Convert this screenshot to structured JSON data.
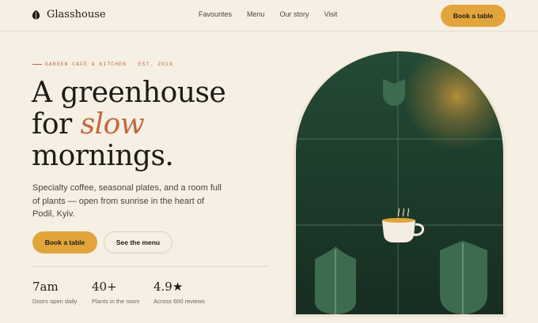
{
  "nav": {
    "brand": "Glasshouse",
    "links": [
      "Favourites",
      "Menu",
      "Our story",
      "Visit"
    ],
    "cta": "Book a table"
  },
  "hero": {
    "eyebrow": "GARDEN CAFÉ & KITCHEN · EST. 2019",
    "headline": {
      "line1": "A greenhouse",
      "line2_pre": "for ",
      "line2_accent": "slow",
      "line3": "mornings."
    },
    "lede": "Specialty coffee, seasonal plates, and a room full of plants — open from sunrise in the heart of Podil, Kyiv.",
    "primary_cta": "Book a table",
    "secondary_cta": "See the menu"
  },
  "stats": [
    {
      "value": "7am",
      "label": "Doors open daily"
    },
    {
      "value": "40+",
      "label": "Plants in the room"
    },
    {
      "value": "4.9★",
      "label": "Across 600 reviews"
    }
  ],
  "colors": {
    "background": "#f5efe4",
    "accent_gold": "#e2a53c",
    "accent_terracotta": "#c06a3c",
    "window_green": "#1f3d2d",
    "leaf_green": "#3d6b4f",
    "ink": "#1e1c17"
  },
  "icons": {
    "brand": "leaf-icon",
    "illustration": "cup-icon"
  }
}
